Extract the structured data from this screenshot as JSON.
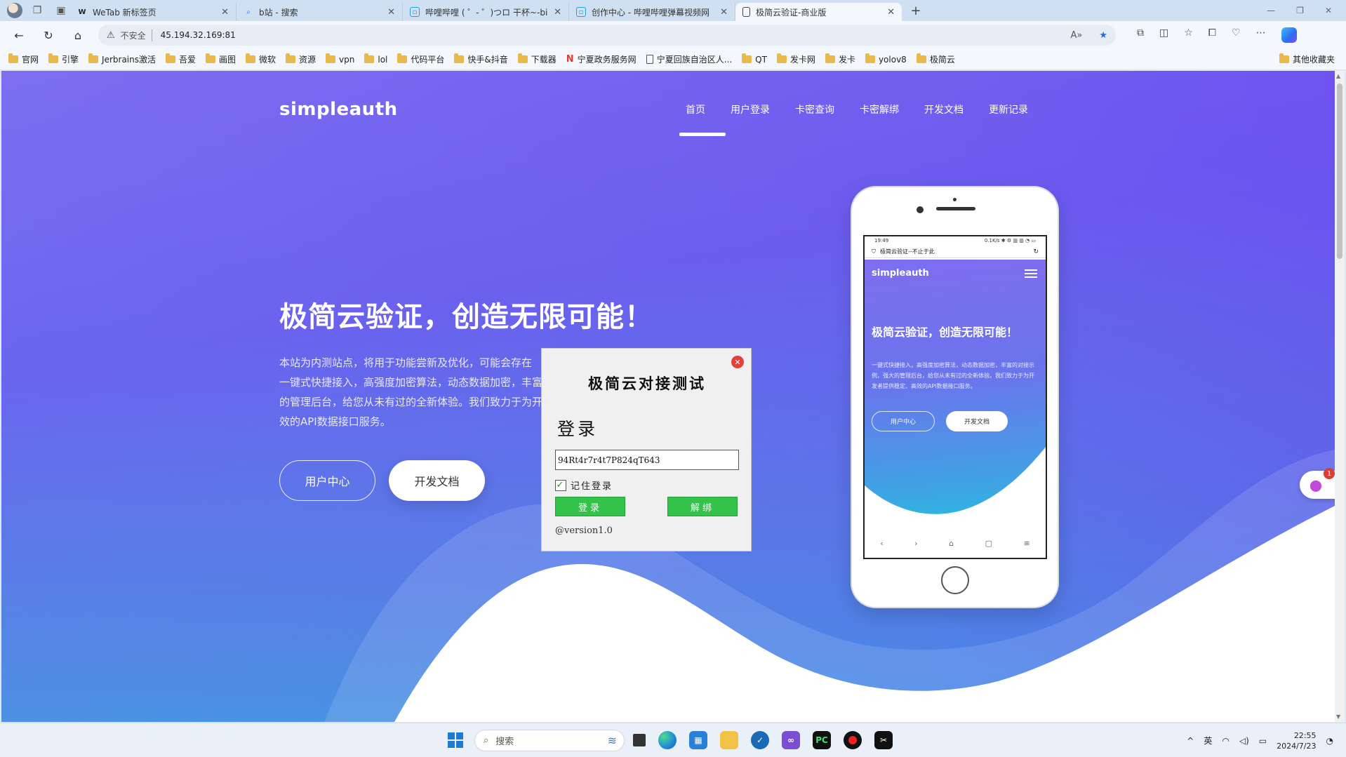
{
  "browser": {
    "tabs": [
      {
        "label": "WeTab 新标签页",
        "icon": "wetab-icon"
      },
      {
        "label": "b站 - 搜索",
        "icon": "search-icon"
      },
      {
        "label": "哔哩哔哩 ( ゜- ゜)つロ 干杯~-bili",
        "icon": "bilibili-icon"
      },
      {
        "label": "创作中心 - 哔哩哔哩弹幕视频网",
        "icon": "bilibili-icon"
      },
      {
        "label": "极简云验证-商业版",
        "icon": "page-icon",
        "active": true
      }
    ],
    "address": {
      "security_label": "不安全",
      "url": "45.194.32.169:81"
    },
    "bookmarks": [
      "官网",
      "引擎",
      "Jerbrains激活",
      "吾爱",
      "画图",
      "微软",
      "资源",
      "vpn",
      "lol",
      "代码平台",
      "快手&抖音",
      "下载器",
      "宁夏政务服务网",
      "宁夏回族自治区人...",
      "QT",
      "发卡网",
      "发卡",
      "yolov8",
      "极简云"
    ],
    "other_bookmarks": "其他收藏夹"
  },
  "site": {
    "logo": "simpleauth",
    "nav": [
      "首页",
      "用户登录",
      "卡密查询",
      "卡密解绑",
      "开发文档",
      "更新记录"
    ],
    "hero_title": "极简云验证，创造无限可能！",
    "hero_desc_lines": [
      "本站为内测站点，将用于功能尝新及优化，可能会存在",
      "一键式快捷接入，高强度加密算法，动态数据加密，丰富的",
      "的管理后台，给您从未有过的全新体验。我们致力于为开",
      "效的API数据接口服务。"
    ],
    "btn_user_center": "用户中心",
    "btn_docs": "开发文档"
  },
  "phone": {
    "status_time": "19:49",
    "status_right": "0.1K/s ✱ ⚙ ▥ ▥ ◔ ▭",
    "addr_title": "极简云验证--不止于此",
    "logo": "simpleauth",
    "title": "极简云验证，创造无限可能！",
    "desc": "一键式快捷接入，高强度加密算法，动态数据加密，丰富的对接示例，强大的管理后台，给您从未有过的全新体验。我们致力于为开发者提供稳定、高效的API数据接口服务。",
    "btn1": "用户中心",
    "btn2": "开发文档",
    "nav_icons": [
      "‹",
      "›",
      "⌂",
      "▢",
      "≡"
    ]
  },
  "dialog": {
    "title": "极简云对接测试",
    "heading": "登录",
    "card_value": "94Rt4r7r4t7P824qT643",
    "remember_label": "记住登录",
    "remember_checked": true,
    "login_button": "登录",
    "unbind_button": "解绑",
    "version": "@version1.0"
  },
  "float_badge_count": "1",
  "taskbar": {
    "search_placeholder": "搜索",
    "ime": "英",
    "time": "22:55",
    "date": "2024/7/23"
  },
  "colors": {
    "dialog_button": "#33c24a",
    "close_button": "#e2403a",
    "accent": "#1f6fd6"
  }
}
